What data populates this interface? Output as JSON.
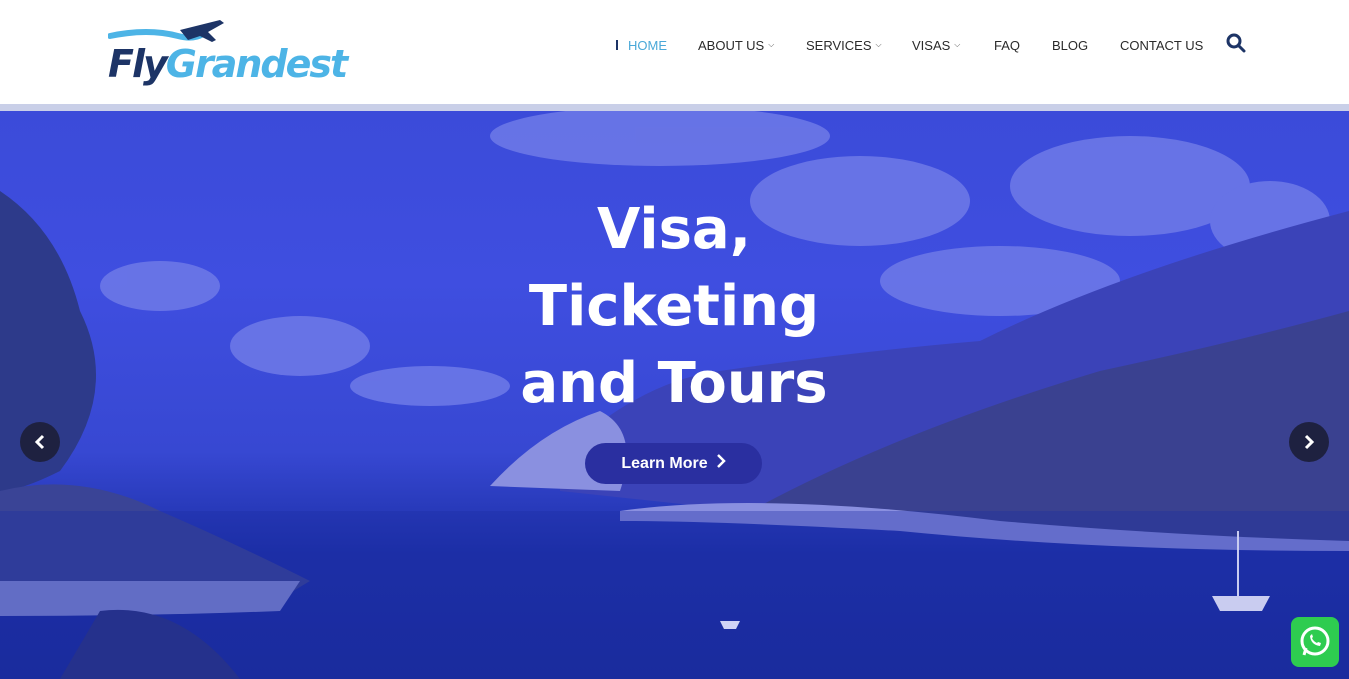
{
  "brand": {
    "logo_fly": "Fly",
    "logo_grandest": "Grandest"
  },
  "nav": {
    "items": [
      {
        "label": "HOME",
        "active": true,
        "dropdown": false
      },
      {
        "label": "ABOUT US",
        "active": false,
        "dropdown": true
      },
      {
        "label": "SERVICES",
        "active": false,
        "dropdown": true
      },
      {
        "label": "VISAS",
        "active": false,
        "dropdown": true
      },
      {
        "label": "FAQ",
        "active": false,
        "dropdown": false
      },
      {
        "label": "BLOG",
        "active": false,
        "dropdown": false
      },
      {
        "label": "CONTACT US",
        "active": false,
        "dropdown": false
      }
    ],
    "search_icon": "search-icon"
  },
  "hero": {
    "title_line1": "Visa,",
    "title_line2": "Ticketing",
    "title_line3": "and Tours",
    "cta_label": "Learn More",
    "prev_icon": "chevron-left-icon",
    "next_icon": "chevron-right-icon"
  },
  "widgets": {
    "whatsapp_icon": "whatsapp-icon"
  },
  "colors": {
    "brand_dark": "#1d3466",
    "brand_light": "#4db4e6",
    "active_nav": "#4aa8d8",
    "hero_overlay": "#3b4bd9",
    "cta_bg": "#2a2fa0",
    "whatsapp": "#2ecc50"
  }
}
